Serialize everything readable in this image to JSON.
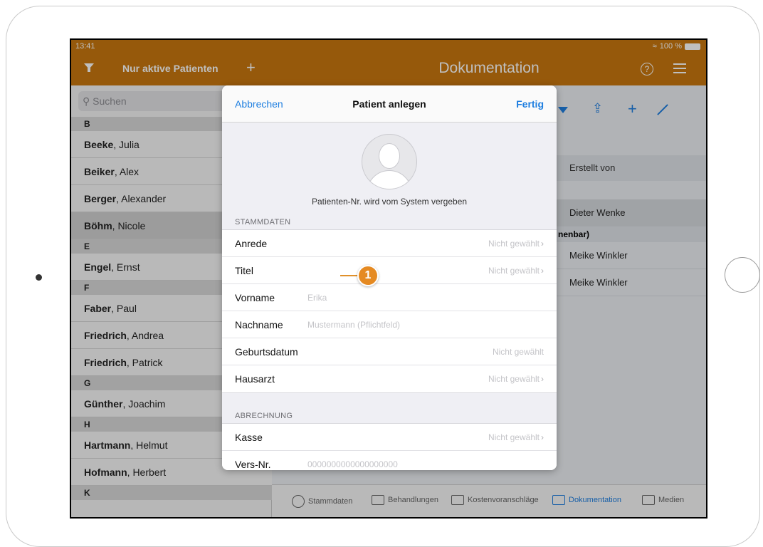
{
  "status": {
    "time": "13:41",
    "battery": "100 %"
  },
  "sidebar": {
    "filter_label": "Nur aktive Patienten",
    "search_placeholder": "Suchen",
    "rows": [
      {
        "type": "section",
        "label": "B"
      },
      {
        "type": "patient",
        "last": "Beeke",
        "first": ", Julia"
      },
      {
        "type": "patient",
        "last": "Beiker",
        "first": ", Alex"
      },
      {
        "type": "patient",
        "last": "Berger",
        "first": ", Alexander"
      },
      {
        "type": "patient",
        "last": "Böhm",
        "first": ", Nicole",
        "selected": true
      },
      {
        "type": "section",
        "label": "E"
      },
      {
        "type": "patient",
        "last": "Engel",
        "first": ", Ernst"
      },
      {
        "type": "section",
        "label": "F"
      },
      {
        "type": "patient",
        "last": "Faber",
        "first": ", Paul"
      },
      {
        "type": "patient",
        "last": "Friedrich",
        "first": ", Andrea"
      },
      {
        "type": "patient",
        "last": "Friedrich",
        "first": ", Patrick"
      },
      {
        "type": "section",
        "label": "G"
      },
      {
        "type": "patient",
        "last": "Günther",
        "first": ", Joachim"
      },
      {
        "type": "section",
        "label": "H"
      },
      {
        "type": "patient",
        "last": "Hartmann",
        "first": ", Helmut"
      },
      {
        "type": "patient",
        "last": "Hofmann",
        "first": ", Herbert"
      },
      {
        "type": "section",
        "label": "K"
      }
    ]
  },
  "nav": {
    "title": "Dokumentation"
  },
  "content": {
    "column_header": "Erstellt von",
    "rows": [
      "Dieter Wenke",
      "Meike Winkler",
      "Meike Winkler"
    ],
    "group_label": "nenbar)"
  },
  "tabbar": {
    "tabs": [
      {
        "label": "Stammdaten",
        "active": false
      },
      {
        "label": "Behandlungen",
        "active": false
      },
      {
        "label": "Kostenvoranschläge",
        "active": false
      },
      {
        "label": "Dokumentation",
        "active": true
      },
      {
        "label": "Medien",
        "active": false
      }
    ]
  },
  "modal": {
    "cancel": "Abbrechen",
    "title": "Patient anlegen",
    "done": "Fertig",
    "patient_nr_note": "Patienten-Nr. wird vom System vergeben",
    "section_stammdaten": "STAMMDATEN",
    "section_abrechnung": "ABRECHNUNG",
    "fields": {
      "anrede": {
        "label": "Anrede",
        "value": "Nicht gewählt"
      },
      "titel": {
        "label": "Titel",
        "value": "Nicht gewählt"
      },
      "vorname": {
        "label": "Vorname",
        "placeholder": "Erika"
      },
      "nachname": {
        "label": "Nachname",
        "placeholder": "Mustermann (Pflichtfeld)"
      },
      "geburtsdatum": {
        "label": "Geburtsdatum",
        "value": "Nicht gewählt"
      },
      "hausarzt": {
        "label": "Hausarzt",
        "value": "Nicht gewählt"
      },
      "kasse": {
        "label": "Kasse",
        "value": "Nicht gewählt"
      },
      "versnr": {
        "label": "Vers-Nr.",
        "placeholder": "0000000000000000000"
      }
    }
  },
  "callout": {
    "number": "1"
  },
  "colors": {
    "accent": "#c8770f",
    "link": "#1f7fe0",
    "callout": "#e58a22"
  }
}
